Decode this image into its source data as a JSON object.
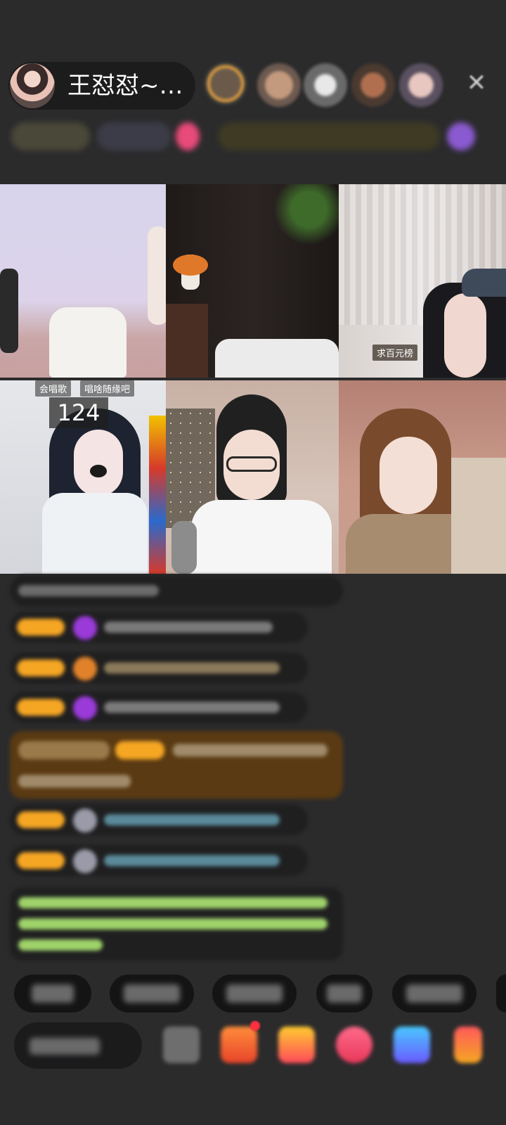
{
  "header": {
    "host_name": "王怼怼~…",
    "close_icon": "close-icon"
  },
  "grid": {
    "tiles": [
      {
        "id": 1,
        "badges": []
      },
      {
        "id": 2,
        "badges": []
      },
      {
        "id": 3,
        "badges": [
          "求百元榜"
        ]
      },
      {
        "id": 4,
        "badges": [
          "会唱歌",
          "唱啥随缘吧"
        ],
        "score": "124"
      },
      {
        "id": 5,
        "badges": []
      },
      {
        "id": 6,
        "badges": []
      }
    ]
  },
  "colors": {
    "background": "#2b2b2c",
    "level_badge": "#f5a623",
    "gift_banner": "#5a3a12",
    "system_text": "#9fd36a"
  }
}
